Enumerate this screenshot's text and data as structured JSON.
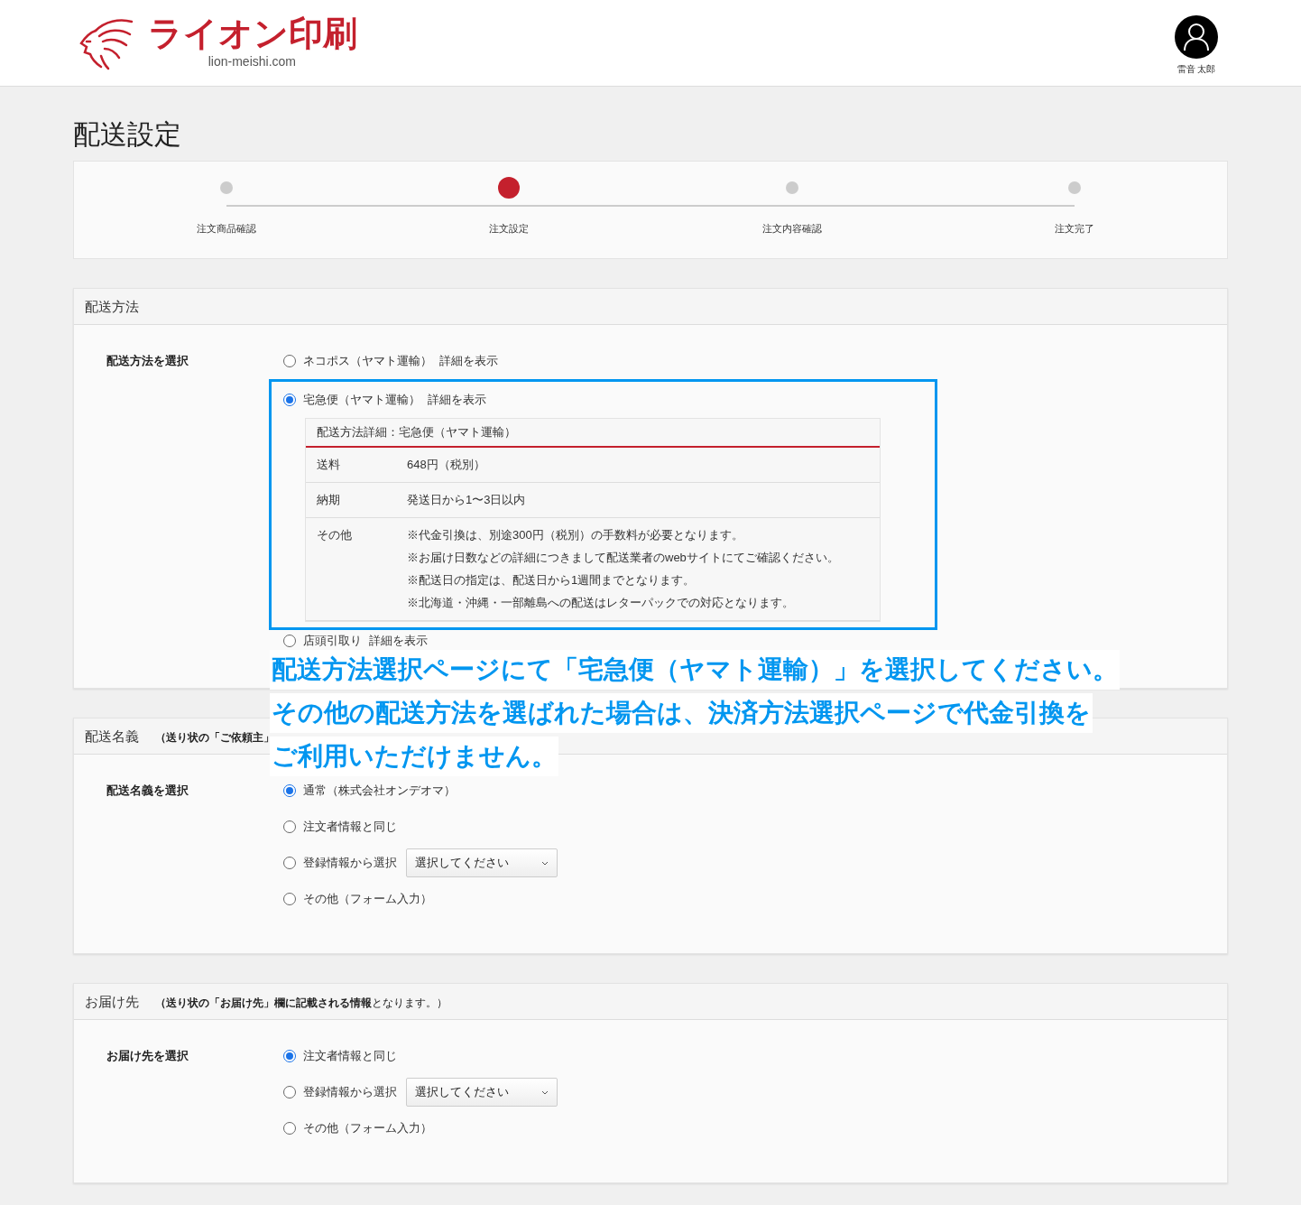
{
  "header": {
    "logo_text": "ライオン印刷",
    "domain": "lion-meishi.com",
    "user_name": "雷音 太郎"
  },
  "page_title": "配送設定",
  "steps": [
    {
      "label": "注文商品確認",
      "selected": false
    },
    {
      "label": "注文設定",
      "selected": true
    },
    {
      "label": "注文内容確認",
      "selected": false
    },
    {
      "label": "注文完了",
      "selected": false
    }
  ],
  "shipping_method": {
    "title": "配送方法",
    "field_label": "配送方法を選択",
    "options": [
      {
        "label": "ネコポス（ヤマト運輸）",
        "detail_link": "詳細を表示",
        "selected": false
      },
      {
        "label": "宅急便（ヤマト運輸）",
        "detail_link": "詳細を表示",
        "selected": true
      },
      {
        "label": "店頭引取り",
        "detail_link": "詳細を表示",
        "selected": false
      }
    ],
    "details": {
      "title": "配送方法詳細：宅急便（ヤマト運輸）",
      "rows": [
        {
          "label": "送料",
          "lines": [
            "648円（税別）"
          ]
        },
        {
          "label": "納期",
          "lines": [
            "発送日から1〜3日以内"
          ]
        },
        {
          "label": "その他",
          "lines": [
            "※代金引換は、別途300円（税別）の手数料が必要となります。",
            "※お届け日数などの詳細につきまして配送業者のwebサイトにてご確認ください。",
            "※配送日の指定は、配送日から1週間までとなります。",
            "※北海道・沖縄・一部離島への配送はレターパックでの対応となります。"
          ]
        }
      ]
    }
  },
  "annotation": {
    "lines": [
      "配送方法選択ページにて「宅急便（ヤマト運輸）」を選択してください。",
      "その他の配送方法を選ばれた場合は、決済方法選択ページで代金引換を",
      "ご利用いただけません。"
    ]
  },
  "sender": {
    "title": "配送名義",
    "note": "**（送り状の「ご依頼主」**",
    "field_label": "配送名義を選択",
    "options": [
      {
        "kind": "plain",
        "label": "通常（株式会社オンデオマ）",
        "selected": true
      },
      {
        "kind": "plain",
        "label": "注文者情報と同じ",
        "selected": false
      },
      {
        "kind": "select",
        "label": "登録情報から選択",
        "select_value": "選択してください",
        "selected": false
      },
      {
        "kind": "plain",
        "label": "その他（フォーム入力）",
        "selected": false
      }
    ]
  },
  "destination": {
    "title": "お届け先",
    "note": "**（送り状の「お届け先」欄に記載される情報**となります。）",
    "field_label": "お届け先を選択",
    "options": [
      {
        "kind": "plain",
        "label": "注文者情報と同じ",
        "selected": true
      },
      {
        "kind": "select",
        "label": "登録情報から選択",
        "select_value": "選択してください",
        "selected": false
      },
      {
        "kind": "plain",
        "label": "その他（フォーム入力）",
        "selected": false
      }
    ]
  }
}
